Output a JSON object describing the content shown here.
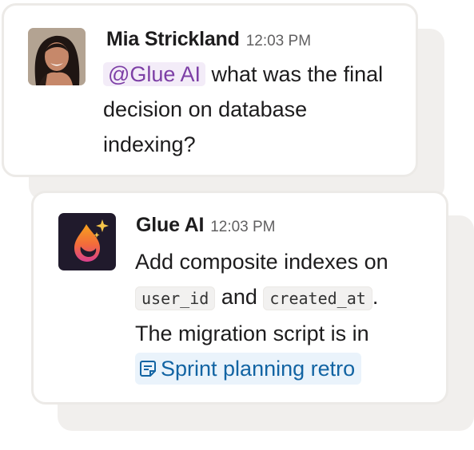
{
  "thread": {
    "question": {
      "sender": "Mia Strickland",
      "time": "12:03 PM",
      "mention": "@Glue AI",
      "text": "what was the final decision on database indexing?"
    },
    "answer": {
      "sender": "Glue AI",
      "time": "12:03 PM",
      "text_1": "Add composite indexes on",
      "code_1": "user_id",
      "text_2": "and",
      "code_2": "created_at",
      "text_3": ".",
      "text_4": "The migration script is in",
      "link": "Sprint planning retro"
    }
  },
  "colors": {
    "mention_bg": "#f3ecf8",
    "mention_text": "#7d3fa6",
    "link_text": "#1264a3",
    "link_bg": "#eaf3fb"
  },
  "icons": {
    "doc_link": "document-icon",
    "glue_logo": "glue-drop-sparkle-icon"
  }
}
